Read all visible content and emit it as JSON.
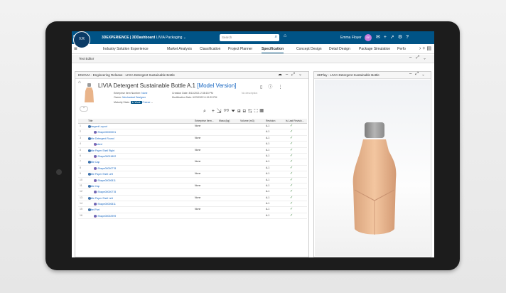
{
  "topbar": {
    "brand": "3DEXPERIENCE | 3DDashboard",
    "dashboard": "LIVIA Packaging",
    "search_placeholder": "Search",
    "user": "Emma Floyer",
    "user_initials": "EF"
  },
  "logo": {
    "text": "V.R"
  },
  "tabs": [
    {
      "label": "Industry Solution Experience"
    },
    {
      "label": "Market Analysis"
    },
    {
      "label": "Classification"
    },
    {
      "label": "Project Planner"
    },
    {
      "label": "Specification"
    },
    {
      "label": "Concept Design"
    },
    {
      "label": "Detail Design"
    },
    {
      "label": "Package Simulation"
    },
    {
      "label": "Perfo"
    }
  ],
  "text_editor": {
    "label": "Text Editor"
  },
  "left_panel": {
    "header": "ENOVIA - Engineering Release - LIVIA Detergent Sustainable Bottle",
    "object_title": "LIVIA Detergent Sustainable Bottle A.1",
    "object_rev": "[Model Version]",
    "attrs": {
      "ent_label": "Enterprise Item Number:",
      "ent_value": "None",
      "owner_label": "Owner:",
      "owner_value": "Mechanical Designer",
      "maturity_label": "Maturity State:",
      "maturity_value": "In Work",
      "maturity_extra": "Freeze",
      "creation_label": "Creation Date:",
      "creation_value": "8/11/2021 2:38:18 PM",
      "mod_label": "Modification Date:",
      "mod_value": "6/23/2022 6:19:33 PM",
      "lock_text": "No description"
    },
    "columns": [
      "Title",
      "Enterprise Item...",
      "Mass (kg)",
      "Volume (m3)",
      "Revision",
      "Is Last Revisio..."
    ],
    "rows": [
      {
        "num": "1",
        "title": "Detergent Layout",
        "ent": "None",
        "rev": "A.1",
        "indent": 0
      },
      {
        "num": "2",
        "title": "3D Shape00000001",
        "ent": "",
        "rev": "A.1",
        "indent": 1
      },
      {
        "num": "3",
        "title": "Bottle Detergent Round",
        "ent": "None",
        "rev": "A.1",
        "indent": 0
      },
      {
        "num": "4",
        "title": "Packed",
        "ent": "",
        "rev": "A.1",
        "indent": 1
      },
      {
        "num": "5",
        "title": "Bottle Paper Shell Right",
        "ent": "None",
        "rev": "A.1",
        "indent": 0
      },
      {
        "num": "6",
        "title": "3D Shape00001802",
        "ent": "",
        "rev": "A.1",
        "indent": 1
      },
      {
        "num": "7",
        "title": "Bottle Cap",
        "ent": "None",
        "rev": "A.1",
        "indent": 0
      },
      {
        "num": "8",
        "title": "3D Shape00000778",
        "ent": "",
        "rev": "A.1",
        "indent": 1
      },
      {
        "num": "9",
        "title": "Bottle Paper Shell Left",
        "ent": "None",
        "rev": "A.1",
        "indent": 0
      },
      {
        "num": "10",
        "title": "3D Shape00000811",
        "ent": "",
        "rev": "A.1",
        "indent": 1
      },
      {
        "num": "11",
        "title": "Bottle Cap",
        "ent": "None",
        "rev": "A.1",
        "indent": 0
      },
      {
        "num": "12",
        "title": "3D Shape00000778",
        "ent": "",
        "rev": "A.1",
        "indent": 1
      },
      {
        "num": "13",
        "title": "Bottle Paper Shell Left",
        "ent": "None",
        "rev": "A.1",
        "indent": 0
      },
      {
        "num": "14",
        "title": "3D Shape00000811",
        "ent": "",
        "rev": "A.1",
        "indent": 1
      },
      {
        "num": "15",
        "title": "Label Part",
        "ent": "None",
        "rev": "A.1",
        "indent": 0
      },
      {
        "num": "16",
        "title": "3D Shape00002999",
        "ent": "",
        "rev": "A.1",
        "indent": 1
      }
    ]
  },
  "right_panel": {
    "header": "3DPlay - LIVIA Detergent Sustainable Bottle"
  },
  "colors": {
    "brand": "#005386",
    "link": "#1565c0",
    "check": "#2e7d32",
    "bottle": "#f0c09a",
    "cap": "#9a9a9a"
  }
}
